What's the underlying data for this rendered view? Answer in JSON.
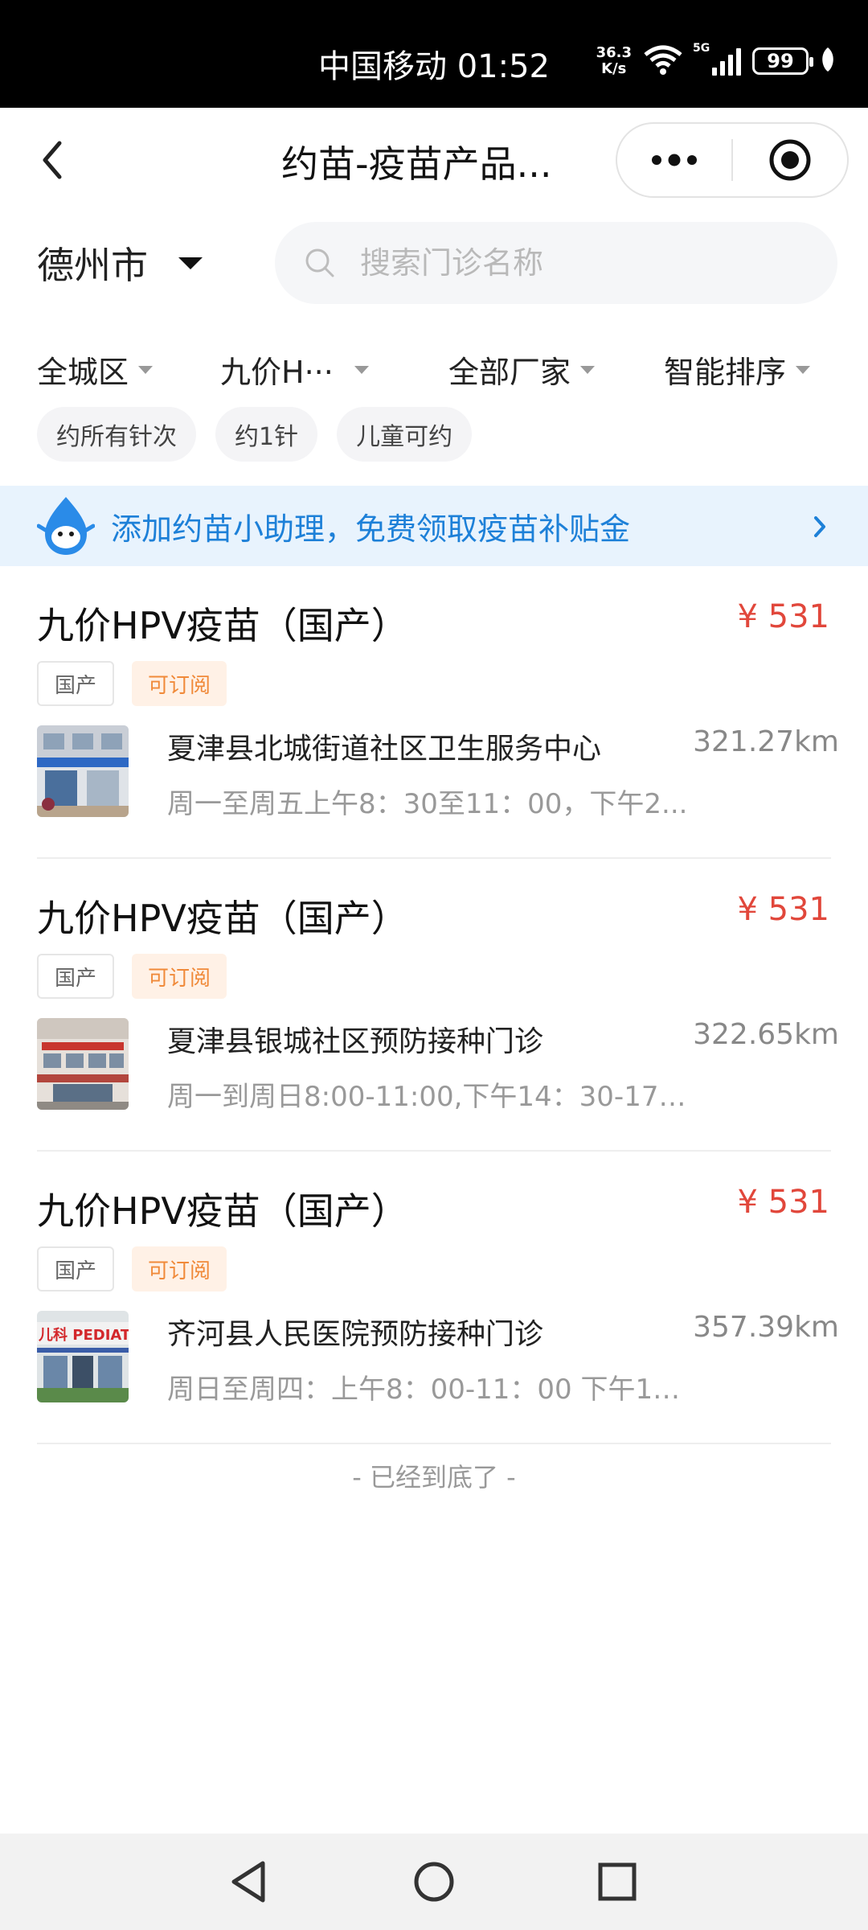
{
  "status": {
    "carrier": "中国移动",
    "time": "01:52",
    "net_speed_value": "36.3",
    "net_speed_unit": "K/s",
    "signal_type": "5G",
    "battery": "99"
  },
  "nav": {
    "title": "约苗-疫苗产品..."
  },
  "location": {
    "city": "德州市"
  },
  "search": {
    "placeholder": "搜索门诊名称",
    "value": ""
  },
  "filters": [
    {
      "label": "全城区"
    },
    {
      "label": "九价H···"
    },
    {
      "label": "全部厂家"
    },
    {
      "label": "智能排序"
    }
  ],
  "chips": [
    "约所有针次",
    "约1针",
    "儿童可约"
  ],
  "banner": {
    "text": "添加约苗小助理，免费领取疫苗补贴金"
  },
  "items": [
    {
      "name": "九价HPV疫苗（国产）",
      "price": "¥ 531",
      "tags": [
        "国产",
        "可订阅"
      ],
      "clinic": "夏津县北城街道社区卫生服务中心",
      "distance": "321.27km",
      "hours": "周一至周五上午8：30至11：00，下午2..."
    },
    {
      "name": "九价HPV疫苗（国产）",
      "price": "¥ 531",
      "tags": [
        "国产",
        "可订阅"
      ],
      "clinic": "夏津县银城社区预防接种门诊",
      "distance": "322.65km",
      "hours": "周一到周日8:00-11:00,下午14：30-17：..."
    },
    {
      "name": "九价HPV疫苗（国产）",
      "price": "¥ 531",
      "tags": [
        "国产",
        "可订阅"
      ],
      "clinic": "齐河县人民医院预防接种门诊",
      "distance": "357.39km",
      "hours": "周日至周四：上午8：00-11：00 下午13..."
    }
  ],
  "thumb3_sign": "儿科 PEDIAT",
  "footer": {
    "end_text": "- 已经到底了 -"
  },
  "colors": {
    "price": "#e1473b",
    "accent_blue": "#1d80d8",
    "tag_orange": "#f08a3a"
  }
}
